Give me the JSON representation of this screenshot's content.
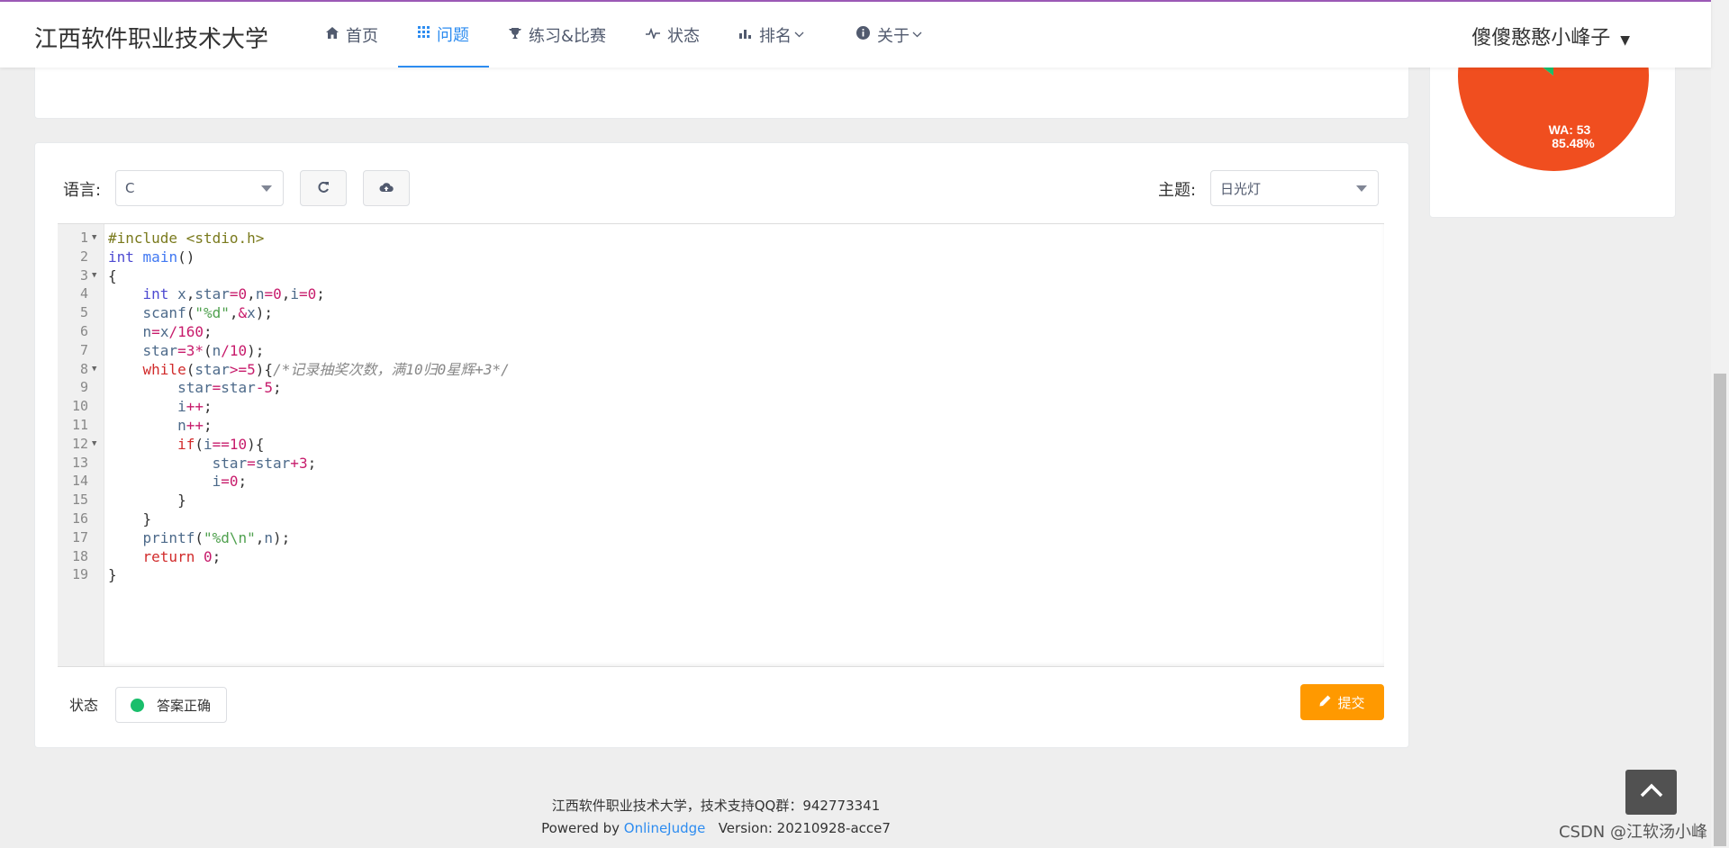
{
  "header": {
    "brand": "江西软件职业技术大学",
    "nav": [
      {
        "icon": "home-icon",
        "label": "首页"
      },
      {
        "icon": "grid-icon",
        "label": "问题"
      },
      {
        "icon": "trophy-icon",
        "label": "练习&比赛"
      },
      {
        "icon": "pulse-icon",
        "label": "状态"
      },
      {
        "icon": "bar-chart-icon",
        "label": "排名"
      },
      {
        "icon": "info-icon",
        "label": "关于"
      }
    ],
    "user": "傻傻憨憨小峰子"
  },
  "pie": {
    "label": "WA: 53",
    "percent": "85.48%",
    "wa_fraction": 0.8548,
    "color_wa": "#f04e1f",
    "color_ac": "#19be6b"
  },
  "editor": {
    "language_label": "语言:",
    "language_value": "C",
    "theme_label": "主题:",
    "theme_value": "日光灯",
    "line_numbers": [
      "1",
      "2",
      "3",
      "4",
      "5",
      "6",
      "7",
      "8",
      "9",
      "10",
      "11",
      "12",
      "13",
      "14",
      "15",
      "16",
      "17",
      "18",
      "19"
    ],
    "code": [
      "#include <stdio.h>",
      "int main()",
      "{",
      "    int x,star=0,n=0,i=0;",
      "    scanf(\"%d\",&x);",
      "    n=x/160;",
      "    star=3*(n/10);",
      "    while(star>=5){/*记录抽奖次数，满10归0星辉+3*/",
      "        star=star-5;",
      "        i++;",
      "        n++;",
      "        if(i==10){",
      "            star=star+3;",
      "            i=0;",
      "        }",
      "    }",
      "    printf(\"%d\\n\",n);",
      "    return 0;",
      "}"
    ]
  },
  "status": {
    "label": "状态",
    "value": "答案正确",
    "color": "#19be6b"
  },
  "submit_label": "提交",
  "footer": {
    "line1": "江西软件职业技术大学，技术支持QQ群：942773341",
    "powered_prefix": "Powered by ",
    "powered_link": "OnlineJudge",
    "version": "Version: 20210928-acce7"
  },
  "watermark": "CSDN @江软汤小峰"
}
